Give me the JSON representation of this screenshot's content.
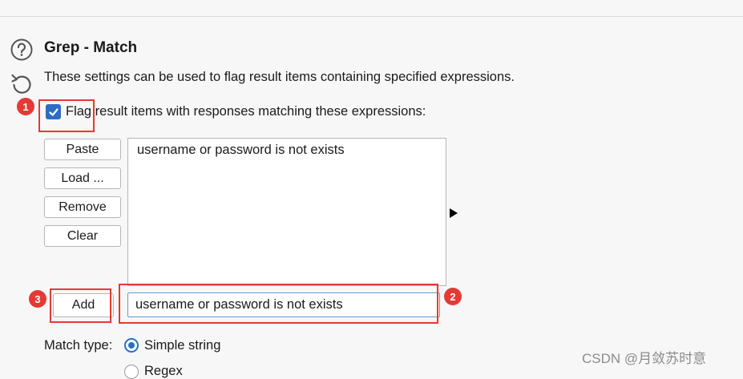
{
  "panel": {
    "title": "Grep - Match",
    "description": "These settings can be used to flag result items containing specified expressions.",
    "checkbox_label": "Flag result items with responses matching these expressions:",
    "checkbox_checked": true
  },
  "buttons": {
    "paste": "Paste",
    "load": "Load ...",
    "remove": "Remove",
    "clear": "Clear",
    "add": "Add"
  },
  "expressions": [
    "username or password is not exists"
  ],
  "add_input": {
    "value": "username or password is not exists",
    "placeholder": ""
  },
  "match_type": {
    "label": "Match type:",
    "options": [
      "Simple string",
      "Regex"
    ],
    "selected": "Simple string"
  },
  "annotations": {
    "badge1": "1",
    "badge2": "2",
    "badge3": "3",
    "color": "#e53935"
  },
  "watermark": "CSDN @月敛苏时意",
  "colors": {
    "accent": "#2d6ec1",
    "background": "#f7f7f7"
  }
}
